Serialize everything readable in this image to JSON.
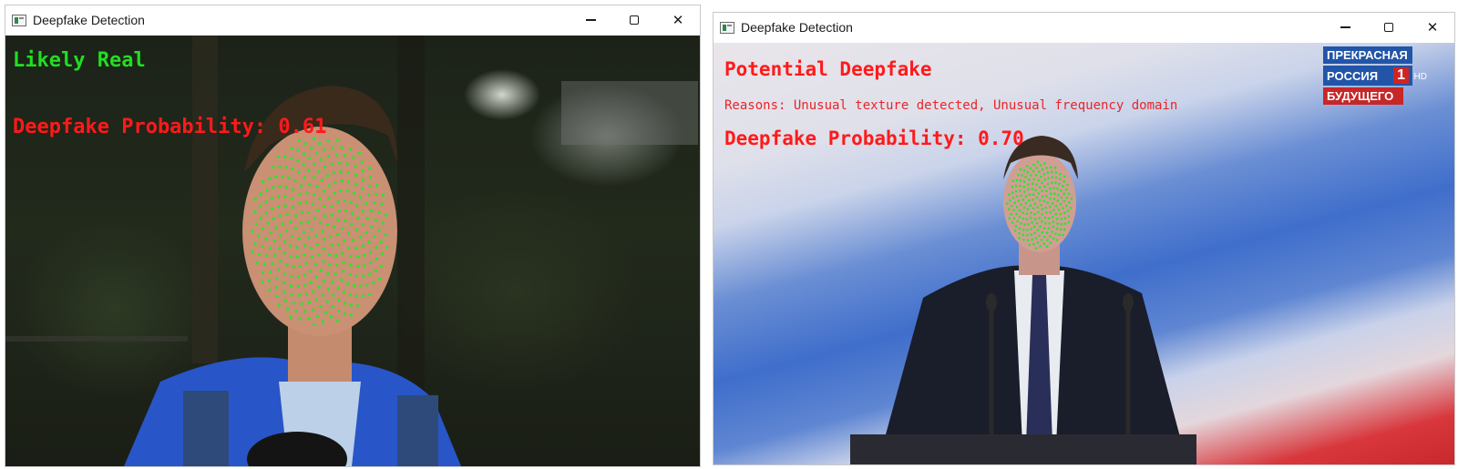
{
  "windows": [
    {
      "title": "Deepfake Detection",
      "verdict": "Likely Real",
      "verdict_color": "#22dd22",
      "probability_label": "Deepfake Probability: 0.61",
      "probability": 0.61,
      "probability_color": "#ff1a1a"
    },
    {
      "title": "Deepfake Detection",
      "verdict": "Potential Deepfake",
      "verdict_color": "#ff1a1a",
      "reasons": "Reasons: Unusual texture detected, Unusual frequency domain",
      "probability_label": "Deepfake Probability: 0.70",
      "probability": 0.7,
      "probability_color": "#ff1a1a",
      "channel_logo": {
        "line1": "ПРЕКРАСНАЯ",
        "line2": "РОССИЯ",
        "line2_number": "1",
        "line3": "БУДУЩЕГО",
        "badge": "HD"
      }
    }
  ],
  "controls": {
    "minimize": "minimize-icon",
    "maximize": "maximize-icon",
    "close": "close-icon",
    "close_glyph": "✕"
  },
  "colors": {
    "landmark": "#29e62c",
    "titlebar": "#ffffff"
  }
}
